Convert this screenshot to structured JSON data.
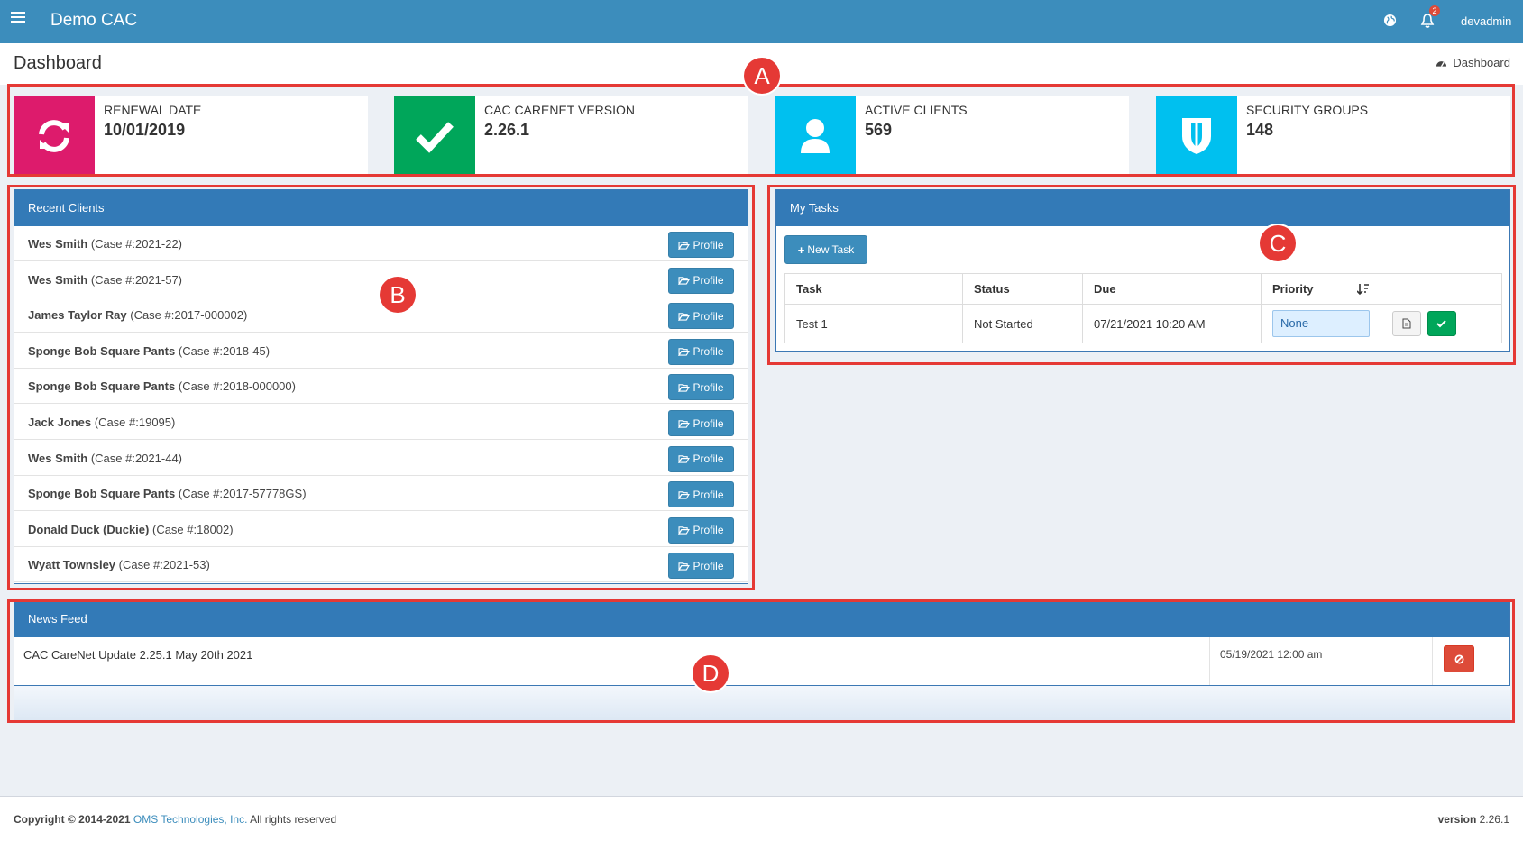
{
  "app": {
    "title": "Demo CAC",
    "notification_count": "2",
    "username": "devadmin"
  },
  "header": {
    "page_title": "Dashboard",
    "breadcrumb": "Dashboard"
  },
  "annotations": {
    "a": "A",
    "b": "B",
    "c": "C",
    "d": "D"
  },
  "info_boxes": [
    {
      "label": "RENEWAL DATE",
      "value": "10/01/2019",
      "icon": "refresh-icon",
      "color": "#dd1b6c"
    },
    {
      "label": "CAC CARENET VERSION",
      "value": "2.26.1",
      "icon": "checkmark-icon",
      "color": "#00a65a"
    },
    {
      "label": "ACTIVE CLIENTS",
      "value": "569",
      "icon": "user-icon",
      "color": "#00c0ef"
    },
    {
      "label": "SECURITY GROUPS",
      "value": "148",
      "icon": "shield-icon",
      "color": "#00c0ef"
    }
  ],
  "recent_clients": {
    "title": "Recent Clients",
    "button_label": "Profile",
    "items": [
      {
        "name": "Wes Smith",
        "case": "(Case #:2021-22)"
      },
      {
        "name": "Wes Smith",
        "case": "(Case #:2021-57)"
      },
      {
        "name": "James Taylor Ray",
        "case": "(Case #:2017-000002)"
      },
      {
        "name": "Sponge Bob Square Pants",
        "case": "(Case #:2018-45)"
      },
      {
        "name": "Sponge Bob Square Pants",
        "case": "(Case #:2018-000000)"
      },
      {
        "name": "Jack Jones",
        "case": "(Case #:19095)"
      },
      {
        "name": "Wes Smith",
        "case": "(Case #:2021-44)"
      },
      {
        "name": "Sponge Bob Square Pants",
        "case": "(Case #:2017-57778GS)"
      },
      {
        "name": "Donald Duck (Duckie)",
        "case": "(Case #:18002)"
      },
      {
        "name": "Wyatt Townsley",
        "case": "(Case #:2021-53)"
      }
    ]
  },
  "tasks": {
    "title": "My Tasks",
    "new_task_label": "New Task",
    "columns": {
      "task": "Task",
      "status": "Status",
      "due": "Due",
      "priority": "Priority"
    },
    "rows": [
      {
        "task": "Test 1",
        "status": "Not Started",
        "due": "07/21/2021 10:20 AM",
        "priority": "None"
      }
    ]
  },
  "news": {
    "title": "News Feed",
    "items": [
      {
        "text": "CAC CareNet Update 2.25.1 May 20th 2021",
        "date": "05/19/2021 12:00 am"
      }
    ]
  },
  "footer": {
    "copyright": "Copyright © 2014-2021",
    "company": "OMS Technologies, Inc.",
    "rights": "All rights reserved",
    "version_label": "version",
    "version": "2.26.1"
  }
}
